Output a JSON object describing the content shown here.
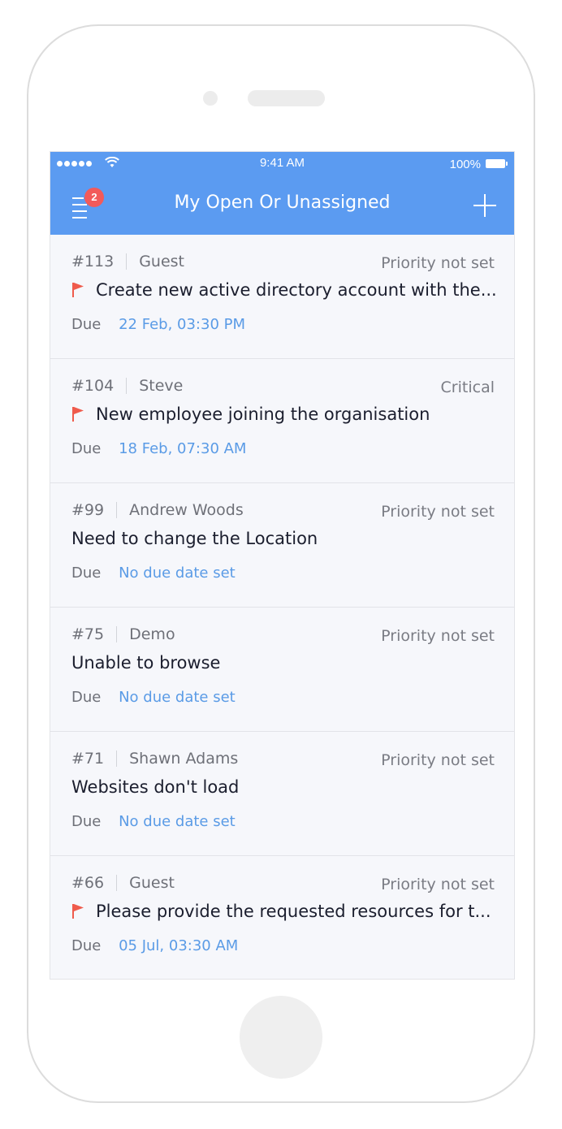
{
  "status_bar": {
    "time": "9:41 AM",
    "battery": "100%"
  },
  "header": {
    "title": "My Open Or Unassigned",
    "badge_count": "2",
    "background_color": "#5b9bf1"
  },
  "tickets": [
    {
      "id": "#113",
      "requester": "Guest",
      "priority": "Priority not set",
      "flagged": true,
      "subject": "Create new active directory account with the...",
      "due_label": "Due",
      "due_value": "22 Feb, 03:30 PM"
    },
    {
      "id": "#104",
      "requester": "Steve",
      "priority": "Critical",
      "flagged": true,
      "subject": "New employee joining the organisation",
      "due_label": "Due",
      "due_value": "18 Feb, 07:30 AM"
    },
    {
      "id": "#99",
      "requester": "Andrew Woods",
      "priority": "Priority not set",
      "flagged": false,
      "subject": "Need to change the Location",
      "due_label": "Due",
      "due_value": "No due date set"
    },
    {
      "id": "#75",
      "requester": "Demo",
      "priority": "Priority not set",
      "flagged": false,
      "subject": "Unable to browse",
      "due_label": "Due",
      "due_value": "No due date set"
    },
    {
      "id": "#71",
      "requester": "Shawn Adams",
      "priority": "Priority not set",
      "flagged": false,
      "subject": "Websites don't load",
      "due_label": "Due",
      "due_value": "No due date set"
    },
    {
      "id": "#66",
      "requester": "Guest",
      "priority": "Priority not set",
      "flagged": true,
      "subject": "Please provide the requested resources for t...",
      "due_label": "Due",
      "due_value": "05 Jul, 03:30 AM"
    }
  ],
  "colors": {
    "flag": "#ef5b4c",
    "due_value": "#5a9be6",
    "badge": "#f25a5a"
  }
}
